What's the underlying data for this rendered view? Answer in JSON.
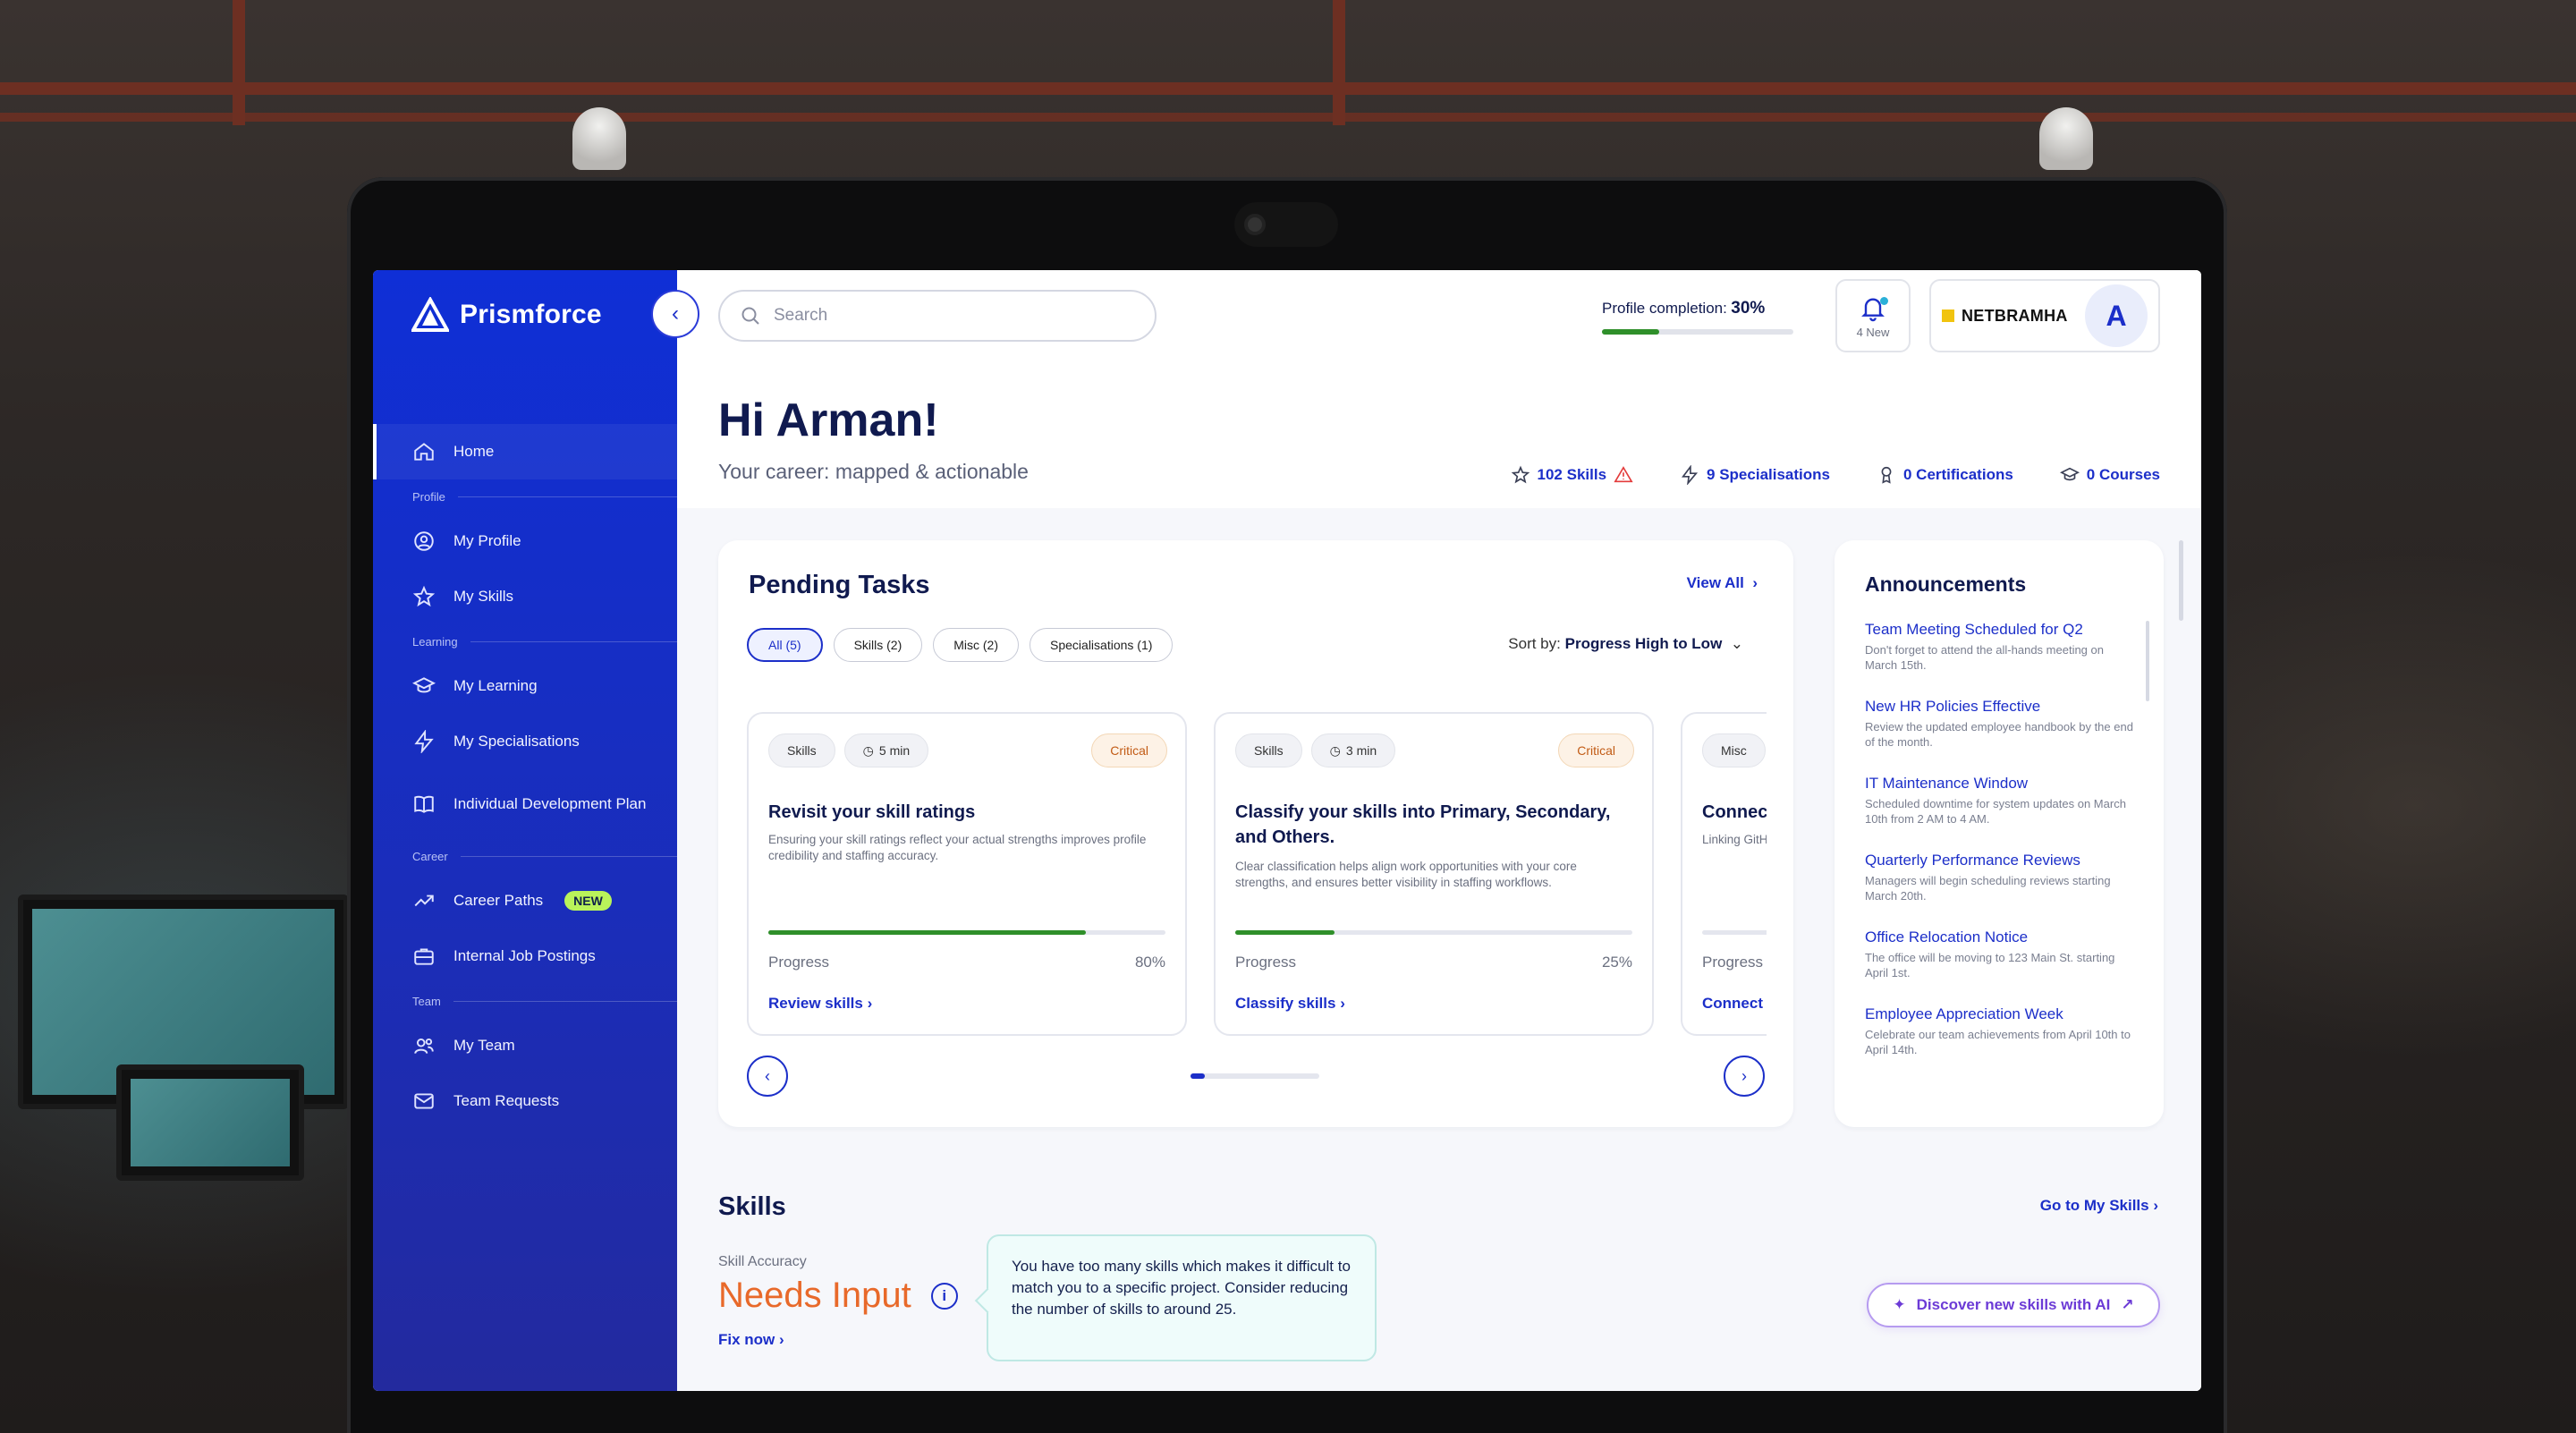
{
  "brand": {
    "name": "Prismforce"
  },
  "sidebar": {
    "items": [
      {
        "label": "Home",
        "icon": "home-icon",
        "active": true
      },
      {
        "section": "Profile"
      },
      {
        "label": "My Profile",
        "icon": "user-circle-icon"
      },
      {
        "label": "My Skills",
        "icon": "star-icon"
      },
      {
        "section": "Learning"
      },
      {
        "label": "My Learning",
        "icon": "graduation-cap-icon"
      },
      {
        "label": "My Specialisations",
        "icon": "lightning-icon"
      },
      {
        "label": "Individual Development Plan",
        "icon": "book-icon"
      },
      {
        "section": "Career"
      },
      {
        "label": "Career Paths",
        "icon": "trend-up-icon",
        "badge": "NEW"
      },
      {
        "label": "Internal Job Postings",
        "icon": "briefcase-icon"
      },
      {
        "section": "Team"
      },
      {
        "label": "My Team",
        "icon": "team-icon"
      },
      {
        "label": "Team Requests",
        "icon": "mail-icon"
      }
    ]
  },
  "header": {
    "search_placeholder": "Search",
    "profile_completion_label": "Profile completion:",
    "profile_completion_value": "30%",
    "profile_completion_fraction": 0.3,
    "notifications_label": "4 New",
    "org_name": "NETBRAMHA",
    "avatar_initial": "A"
  },
  "greeting": {
    "title": "Hi Arman!",
    "subtitle": "Your career: mapped & actionable"
  },
  "stats": {
    "skills": "102 Skills",
    "specialisations": "9 Specialisations",
    "certifications": "0 Certifications",
    "courses": "0 Courses"
  },
  "pending_tasks": {
    "title": "Pending Tasks",
    "view_all": "View All",
    "filters": [
      "All (5)",
      "Skills (2)",
      "Misc (2)",
      "Specialisations (1)"
    ],
    "sort_label": "Sort by:",
    "sort_value": "Progress High to Low",
    "tasks": [
      {
        "category": "Skills",
        "duration": "5 min",
        "priority": "Critical",
        "title": "Revisit your skill ratings",
        "description": "Ensuring your skill ratings reflect your actual strengths improves profile credibility and staffing accuracy.",
        "progress_label": "Progress",
        "progress_value": "80%",
        "progress_fraction": 0.8,
        "action": "Review skills"
      },
      {
        "category": "Skills",
        "duration": "3 min",
        "priority": "Critical",
        "title": "Classify your skills into Primary, Secondary, and Others.",
        "description": "Clear classification helps align work opportunities with your core strengths, and ensures better visibility in staffing workflows.",
        "progress_label": "Progress",
        "progress_value": "25%",
        "progress_fraction": 0.25,
        "action": "Classify skills"
      },
      {
        "category": "Misc",
        "title": "Connect y",
        "description": "Linking GitHul contributions, matchability.",
        "progress_label": "Progress",
        "action": "Connect Gi"
      }
    ]
  },
  "announcements": {
    "title": "Announcements",
    "items": [
      {
        "title": "Team Meeting Scheduled for Q2",
        "desc": "Don't forget to attend the all-hands meeting on March 15th."
      },
      {
        "title": "New HR Policies Effective",
        "desc": "Review the updated employee handbook by the end of the month."
      },
      {
        "title": "IT Maintenance Window",
        "desc": "Scheduled downtime for system updates on March 10th from 2 AM to 4 AM."
      },
      {
        "title": "Quarterly Performance Reviews",
        "desc": "Managers will begin scheduling reviews starting March 20th."
      },
      {
        "title": "Office Relocation Notice",
        "desc": "The office will be moving to 123 Main St. starting April 1st."
      },
      {
        "title": "Employee Appreciation Week",
        "desc": "Celebrate our team achievements from April 10th to April 14th."
      }
    ]
  },
  "skills": {
    "title": "Skills",
    "go_to": "Go to My Skills",
    "accuracy_label": "Skill Accuracy",
    "accuracy_value": "Needs Input",
    "fix_now": "Fix now",
    "tooltip": "You have too many skills which makes it difficult to match you to a specific project. Consider reducing the number of skills to around 25.",
    "discover": "Discover new skills with AI"
  },
  "colors": {
    "brand_blue": "#1c2fc9",
    "sidebar": "#0f2fd6",
    "progress_green": "#2f8f2a",
    "critical": "#c25b15",
    "needs_input": "#e8692a",
    "new_badge": "#b9f35a"
  }
}
